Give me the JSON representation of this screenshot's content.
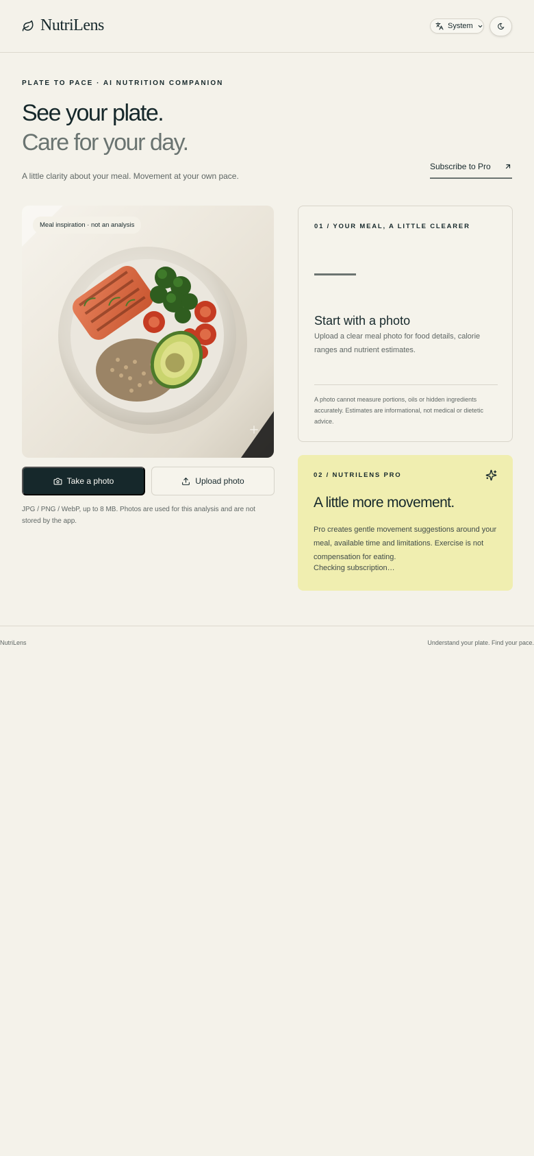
{
  "header": {
    "brand": "NutriLens",
    "brand_icon": "leaf-icon",
    "language_selector": {
      "icon": "translate-icon",
      "value": "System"
    },
    "theme_toggle_icon": "moon-icon"
  },
  "hero": {
    "eyebrow": "PLATE TO PACE · AI NUTRITION COMPANION",
    "title_line1": "See your plate.",
    "title_line2": "Care for your day.",
    "lede": "A little clarity about your meal. Movement at your own pace.",
    "cta": {
      "label": "Subscribe to Pro",
      "icon": "arrow-up-right-icon"
    }
  },
  "photo": {
    "badge": "Meal inspiration · not an analysis",
    "take_label": "Take a photo",
    "upload_label": "Upload photo",
    "note": "JPG / PNG / WebP, up to 8 MB. Photos are used for this analysis and are not stored by the app."
  },
  "meal_card": {
    "eyebrow": "01 / YOUR MEAL, A LITTLE CLEARER",
    "title": "Start with a photo",
    "description": "Upload a clear meal photo for food details, calorie ranges and nutrient estimates.",
    "disclaimer": "A photo cannot measure portions, oils or hidden ingredients accurately. Estimates are informational, not medical or dietetic advice."
  },
  "pro_card": {
    "eyebrow": "02 / NUTRILENS PRO",
    "title": "A little more movement.",
    "description": "Pro creates gentle movement suggestions around your meal, available time and limitations. Exercise is not compensation for eating.",
    "status": "Checking subscription…",
    "icon": "sparkles-icon",
    "accent": "#f0eeb0"
  },
  "footer": {
    "left": "NutriLens",
    "right": "Understand your plate. Find your pace."
  },
  "colors": {
    "background": "#f4f2ea",
    "ink": "#16282b",
    "muted": "#6a7471"
  }
}
